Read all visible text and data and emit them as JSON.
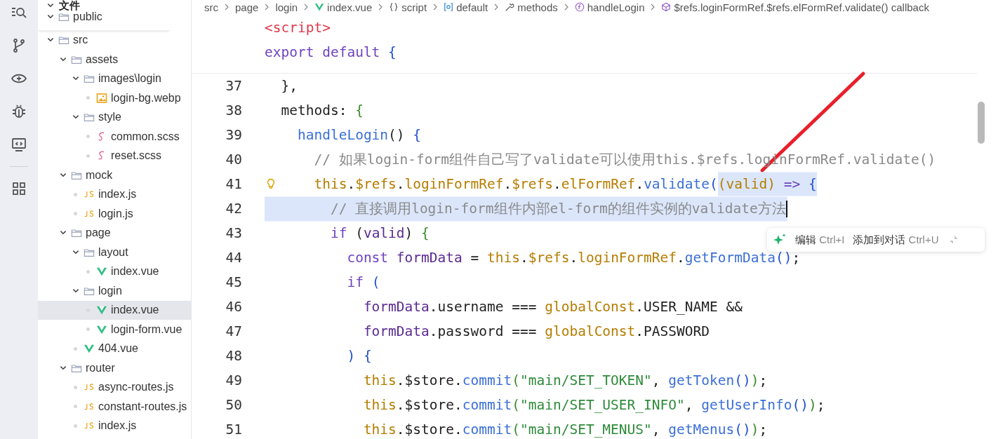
{
  "explorer": {
    "title": "文件",
    "tree": [
      {
        "name": "public",
        "kind": "folder",
        "expanded": true,
        "selected": false
      },
      {
        "name": "src",
        "kind": "folder",
        "expanded": true,
        "selected": false,
        "children": [
          {
            "name": "assets",
            "kind": "folder",
            "expanded": true,
            "selected": false,
            "children": [
              {
                "name": "images\\login",
                "kind": "folder",
                "expanded": true,
                "selected": false,
                "children": [
                  {
                    "name": "login-bg.webp",
                    "kind": "image",
                    "selected": false
                  }
                ]
              },
              {
                "name": "style",
                "kind": "folder",
                "expanded": true,
                "selected": false,
                "children": [
                  {
                    "name": "common.scss",
                    "kind": "scss",
                    "selected": false
                  },
                  {
                    "name": "reset.scss",
                    "kind": "scss",
                    "selected": false
                  }
                ]
              }
            ]
          },
          {
            "name": "mock",
            "kind": "folder",
            "expanded": true,
            "selected": false,
            "children": [
              {
                "name": "index.js",
                "kind": "js",
                "selected": false
              },
              {
                "name": "login.js",
                "kind": "js",
                "selected": false
              }
            ]
          },
          {
            "name": "page",
            "kind": "folder",
            "expanded": true,
            "selected": false,
            "children": [
              {
                "name": "layout",
                "kind": "folder",
                "expanded": true,
                "selected": false,
                "children": [
                  {
                    "name": "index.vue",
                    "kind": "vue",
                    "selected": false
                  }
                ]
              },
              {
                "name": "login",
                "kind": "folder",
                "expanded": true,
                "selected": false,
                "children": [
                  {
                    "name": "index.vue",
                    "kind": "vue",
                    "selected": true
                  },
                  {
                    "name": "login-form.vue",
                    "kind": "vue",
                    "selected": false
                  }
                ]
              },
              {
                "name": "404.vue",
                "kind": "vue",
                "selected": false
              }
            ]
          },
          {
            "name": "router",
            "kind": "folder",
            "expanded": true,
            "selected": false,
            "children": [
              {
                "name": "async-routes.js",
                "kind": "js",
                "selected": false
              },
              {
                "name": "constant-routes.js",
                "kind": "js",
                "selected": false
              },
              {
                "name": "index.js",
                "kind": "js",
                "selected": false
              }
            ]
          }
        ]
      }
    ]
  },
  "breadcrumb": [
    {
      "label": "src",
      "kind": "folder"
    },
    {
      "label": "page",
      "kind": "folder"
    },
    {
      "label": "login",
      "kind": "folder"
    },
    {
      "label": "index.vue",
      "kind": "vue"
    },
    {
      "label": "script",
      "kind": "braces"
    },
    {
      "label": "default",
      "kind": "module"
    },
    {
      "label": "methods",
      "kind": "wrench"
    },
    {
      "label": "handleLogin",
      "kind": "function"
    },
    {
      "label": "$refs.loginFormRef.$refs.elFormRef.validate() callback",
      "kind": "cube"
    }
  ],
  "sticky_lines": [
    [
      {
        "kind": "tag",
        "text": "<script>"
      }
    ],
    [
      {
        "kind": "keyword",
        "text": "export default "
      },
      {
        "kind": "brace",
        "text": "{"
      }
    ]
  ],
  "code_lines": [
    {
      "number": "37",
      "selected": false,
      "tokens": [
        {
          "kind": "plain",
          "text": "  },"
        }
      ]
    },
    {
      "number": "38",
      "selected": false,
      "tokens": [
        {
          "kind": "plain",
          "text": "  methods: "
        },
        {
          "kind": "brace2",
          "text": "{"
        }
      ]
    },
    {
      "number": "39",
      "selected": false,
      "tokens": [
        {
          "kind": "function",
          "text": "    handleLogin"
        },
        {
          "kind": "plain",
          "text": "() "
        },
        {
          "kind": "brace",
          "text": "{"
        }
      ]
    },
    {
      "number": "40",
      "selected": false,
      "tokens": [
        {
          "kind": "comment",
          "text": "      // 如果login-form组件自己写了validate可以使用this.$refs.loginFormRef.validate()"
        }
      ]
    },
    {
      "number": "41",
      "selected": false,
      "hint": true,
      "tokens": [
        {
          "kind": "object",
          "text": "      this"
        },
        {
          "kind": "plain",
          "text": "."
        },
        {
          "kind": "object",
          "text": "$refs"
        },
        {
          "kind": "plain",
          "text": "."
        },
        {
          "kind": "object",
          "text": "loginFormRef"
        },
        {
          "kind": "plain",
          "text": "."
        },
        {
          "kind": "object",
          "text": "$refs"
        },
        {
          "kind": "plain",
          "text": "."
        },
        {
          "kind": "object",
          "text": "elFormRef"
        },
        {
          "kind": "plain",
          "text": "."
        },
        {
          "kind": "function",
          "text": "validate"
        },
        {
          "kind": "brace",
          "text": "("
        },
        {
          "kind": "object",
          "text": "(valid) ",
          "selected": true
        },
        {
          "kind": "keyword",
          "text": "=> ",
          "selected": true
        },
        {
          "kind": "brace",
          "text": "{",
          "selected": true
        }
      ]
    },
    {
      "number": "42",
      "selected": true,
      "tokens": [
        {
          "kind": "comment",
          "text": "        // 直接调用login-form组件内部el-form的组件实例的validate方法"
        }
      ]
    },
    {
      "number": "43",
      "selected": false,
      "tokens": [
        {
          "kind": "keyword",
          "text": "        if "
        },
        {
          "kind": "plain",
          "text": "("
        },
        {
          "kind": "variable",
          "text": "valid"
        },
        {
          "kind": "plain",
          "text": ") "
        },
        {
          "kind": "brace2",
          "text": "{"
        }
      ]
    },
    {
      "number": "44",
      "selected": false,
      "tokens": [
        {
          "kind": "keyword",
          "text": "          const "
        },
        {
          "kind": "variable",
          "text": "formData"
        },
        {
          "kind": "plain",
          "text": " = "
        },
        {
          "kind": "object",
          "text": "this"
        },
        {
          "kind": "plain",
          "text": "."
        },
        {
          "kind": "object",
          "text": "$refs"
        },
        {
          "kind": "plain",
          "text": "."
        },
        {
          "kind": "object",
          "text": "loginFormRef"
        },
        {
          "kind": "plain",
          "text": "."
        },
        {
          "kind": "function",
          "text": "getFormData"
        },
        {
          "kind": "brace",
          "text": "()"
        },
        {
          "kind": "plain",
          "text": ";"
        }
      ]
    },
    {
      "number": "45",
      "selected": false,
      "tokens": [
        {
          "kind": "keyword",
          "text": "          if "
        },
        {
          "kind": "brace",
          "text": "("
        }
      ]
    },
    {
      "number": "46",
      "selected": false,
      "tokens": [
        {
          "kind": "variable",
          "text": "            formData"
        },
        {
          "kind": "plain",
          "text": ".username === "
        },
        {
          "kind": "object",
          "text": "globalConst"
        },
        {
          "kind": "plain",
          "text": ".USER_NAME &&"
        }
      ]
    },
    {
      "number": "47",
      "selected": false,
      "tokens": [
        {
          "kind": "variable",
          "text": "            formData"
        },
        {
          "kind": "plain",
          "text": ".password === "
        },
        {
          "kind": "object",
          "text": "globalConst"
        },
        {
          "kind": "plain",
          "text": ".PASSWORD"
        }
      ]
    },
    {
      "number": "48",
      "selected": false,
      "tokens": [
        {
          "kind": "brace",
          "text": "          ) {"
        }
      ]
    },
    {
      "number": "49",
      "selected": false,
      "tokens": [
        {
          "kind": "object",
          "text": "            this"
        },
        {
          "kind": "plain",
          "text": ".$store."
        },
        {
          "kind": "function",
          "text": "commit"
        },
        {
          "kind": "brace2",
          "text": "("
        },
        {
          "kind": "string",
          "text": "\"main/SET_TOKEN\""
        },
        {
          "kind": "plain",
          "text": ", "
        },
        {
          "kind": "function",
          "text": "getToken"
        },
        {
          "kind": "brace",
          "text": "()"
        },
        {
          "kind": "brace2",
          "text": ")"
        },
        {
          "kind": "plain",
          "text": ";"
        }
      ]
    },
    {
      "number": "50",
      "selected": false,
      "tokens": [
        {
          "kind": "object",
          "text": "            this"
        },
        {
          "kind": "plain",
          "text": ".$store."
        },
        {
          "kind": "function",
          "text": "commit"
        },
        {
          "kind": "brace2",
          "text": "("
        },
        {
          "kind": "string",
          "text": "\"main/SET_USER_INFO\""
        },
        {
          "kind": "plain",
          "text": ", "
        },
        {
          "kind": "function",
          "text": "getUserInfo"
        },
        {
          "kind": "brace",
          "text": "()"
        },
        {
          "kind": "brace2",
          "text": ")"
        },
        {
          "kind": "plain",
          "text": ";"
        }
      ]
    },
    {
      "number": "51",
      "selected": false,
      "tokens": [
        {
          "kind": "object",
          "text": "            this"
        },
        {
          "kind": "plain",
          "text": ".$store."
        },
        {
          "kind": "function",
          "text": "commit"
        },
        {
          "kind": "brace2",
          "text": "("
        },
        {
          "kind": "string",
          "text": "\"main/SET_MENUS\""
        },
        {
          "kind": "plain",
          "text": ", "
        },
        {
          "kind": "function",
          "text": "getMenus"
        },
        {
          "kind": "brace",
          "text": "()"
        },
        {
          "kind": "brace2",
          "text": ")"
        },
        {
          "kind": "plain",
          "text": ";"
        }
      ]
    }
  ],
  "popup": [
    {
      "label": "编辑",
      "shortcut": "Ctrl+I"
    },
    {
      "label": "添加到对话",
      "shortcut": "Ctrl+U"
    }
  ]
}
